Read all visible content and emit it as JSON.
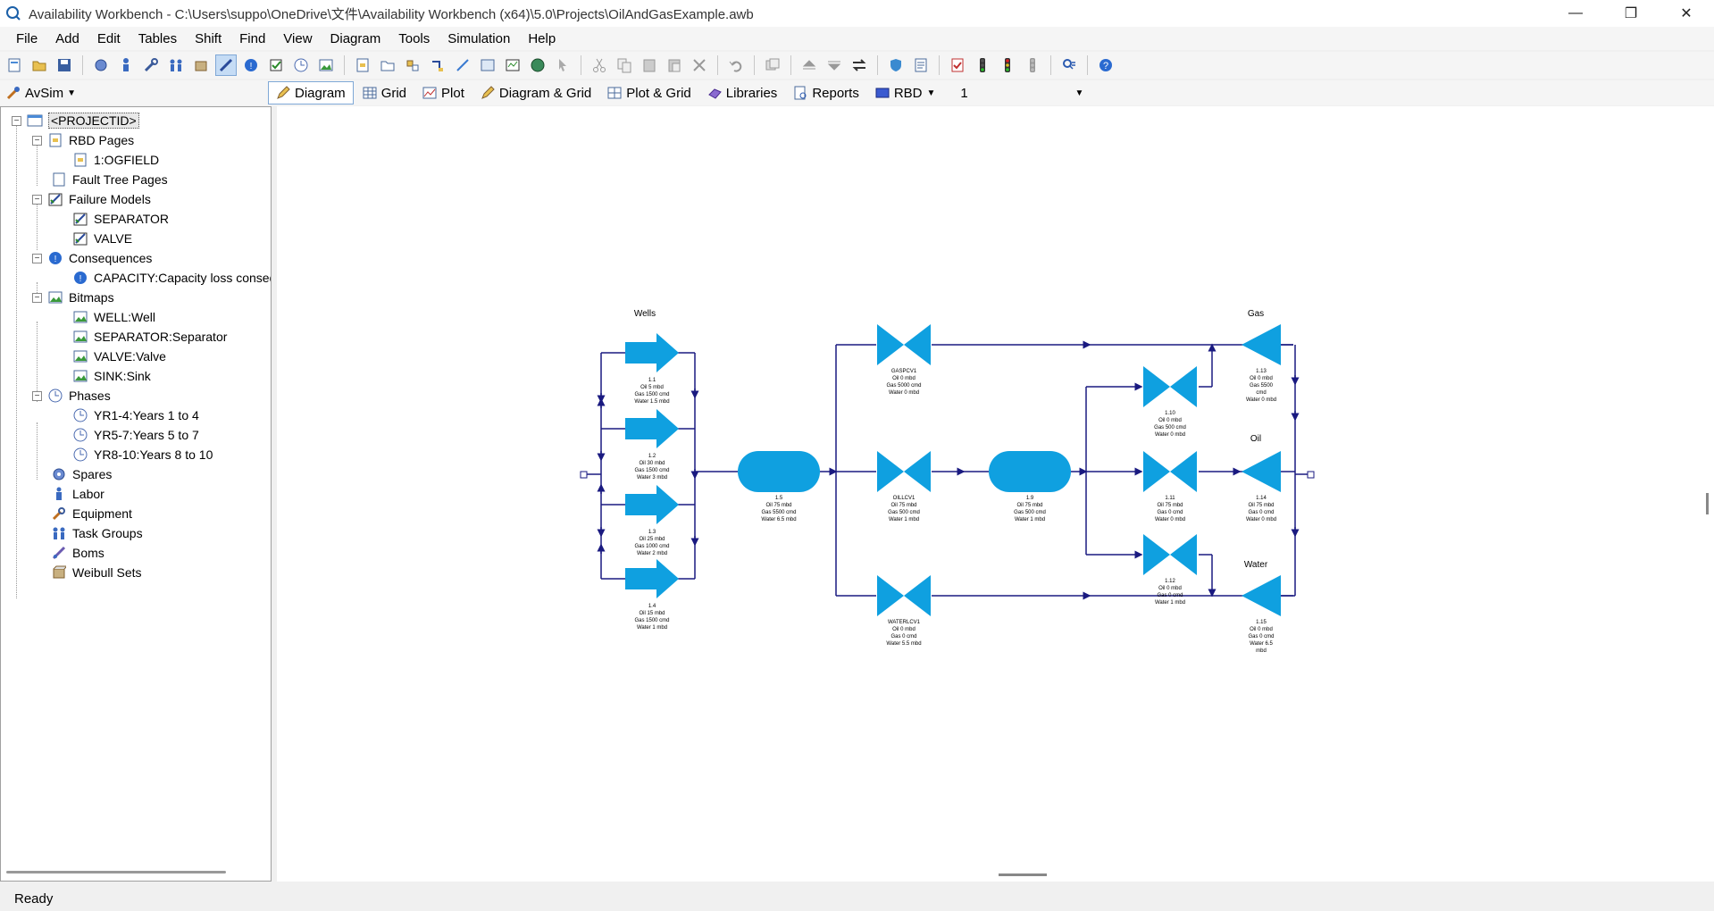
{
  "window": {
    "title": "Availability Workbench - C:\\Users\\suppo\\OneDrive\\文件\\Availability Workbench (x64)\\5.0\\Projects\\OilAndGasExample.awb",
    "minimize": "—",
    "restore": "❐",
    "close": "✕"
  },
  "menu": [
    "File",
    "Add",
    "Edit",
    "Tables",
    "Shift",
    "Find",
    "View",
    "Diagram",
    "Tools",
    "Simulation",
    "Help"
  ],
  "toolbar2": {
    "module": "AvSim",
    "tabs": [
      "Diagram",
      "Grid",
      "Plot",
      "Diagram & Grid",
      "Plot & Grid",
      "Libraries",
      "Reports",
      "RBD"
    ],
    "page_value": "1"
  },
  "tree": {
    "root": "<PROJECTID>",
    "rbd_pages": "RBD Pages",
    "rbd_page_1": "1:OGFIELD",
    "fault_tree_pages": "Fault Tree Pages",
    "failure_models": "Failure Models",
    "fm_separator": "SEPARATOR",
    "fm_valve": "VALVE",
    "consequences": "Consequences",
    "capacity": "CAPACITY:Capacity loss conseq",
    "bitmaps": "Bitmaps",
    "bm_well": "WELL:Well",
    "bm_separator": "SEPARATOR:Separator",
    "bm_valve": "VALVE:Valve",
    "bm_sink": "SINK:Sink",
    "phases": "Phases",
    "ph1": "YR1-4:Years 1 to 4",
    "ph2": "YR5-7:Years 5 to 7",
    "ph3": "YR8-10:Years 8 to 10",
    "spares": "Spares",
    "labor": "Labor",
    "equipment": "Equipment",
    "task_groups": "Task Groups",
    "boms": "Boms",
    "weibull_sets": "Weibull Sets"
  },
  "diagram": {
    "color_block": "#0fa0e0",
    "color_line": "#1a1a80",
    "wells_label": "Wells",
    "gas_label": "Gas",
    "oil_label": "Oil",
    "water_label": "Water",
    "blocks": {
      "w1": [
        "1.1",
        "Oil 5 mbd",
        "Gas 1500 cmd",
        "Water 1.5 mbd"
      ],
      "w2": [
        "1.2",
        "Oil 30 mbd",
        "Gas 1500 cmd",
        "Water 3 mbd"
      ],
      "w3": [
        "1.3",
        "Oil 25 mbd",
        "Gas 1000 cmd",
        "Water 2 mbd"
      ],
      "w4": [
        "1.4",
        "Oil 15 mbd",
        "Gas 1500 cmd",
        "Water 1 mbd"
      ],
      "sep1": [
        "1.5",
        "Oil 75 mbd",
        "Gas 5500 cmd",
        "Water 6.5 mbd"
      ],
      "gascv": [
        "GASPCV1",
        "Oil 0 mbd",
        "Gas 5000 cmd",
        "Water 0 mbd"
      ],
      "oillcv": [
        "OILLCV1",
        "Oil 75 mbd",
        "Gas 500 cmd",
        "Water 1 mbd"
      ],
      "watcv": [
        "WATERLCV1",
        "Oil 0 mbd",
        "Gas 0 cmd",
        "Water 5.5 mbd"
      ],
      "sep2": [
        "1.9",
        "Oil 75 mbd",
        "Gas 500 cmd",
        "Water 1 mbd"
      ],
      "v10": [
        "1.10",
        "Oil 0 mbd",
        "Gas 500 cmd",
        "Water 0 mbd"
      ],
      "v11": [
        "1.11",
        "Oil 75 mbd",
        "Gas 0 cmd",
        "Water 0 mbd"
      ],
      "v12": [
        "1.12",
        "Oil 0 mbd",
        "Gas 0 cmd",
        "Water 1 mbd"
      ],
      "sinkgas": [
        "1.13",
        "Oil 0 mbd",
        "Gas 5500",
        "cmd",
        "Water 0 mbd"
      ],
      "sinkoil": [
        "1.14",
        "Oil 75 mbd",
        "Gas 0 cmd",
        "Water 0 mbd"
      ],
      "sinkwater": [
        "1.15",
        "Oil 0 mbd",
        "Gas 0 cmd",
        "Water 6.5",
        "mbd"
      ]
    }
  },
  "status": "Ready"
}
